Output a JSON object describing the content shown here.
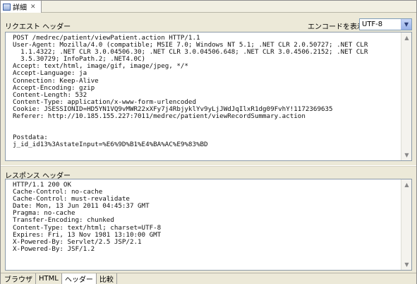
{
  "view": {
    "title": "詳細",
    "close": "✕"
  },
  "request": {
    "label": "リクエスト ヘッダー",
    "encoding_label": "エンコードを表示:",
    "encoding_value": "UTF-8",
    "text": "POST /medrec/patient/viewPatient.action HTTP/1.1\nUser-Agent: Mozilla/4.0 (compatible; MSIE 7.0; Windows NT 5.1; .NET CLR 2.0.50727; .NET CLR\n  1.1.4322; .NET CLR 3.0.04506.30; .NET CLR 3.0.04506.648; .NET CLR 3.0.4506.2152; .NET CLR\n  3.5.30729; InfoPath.2; .NET4.0C)\nAccept: text/html, image/gif, image/jpeg, */*\nAccept-Language: ja\nConnection: Keep-Alive\nAccept-Encoding: gzip\nContent-Length: 532\nContent-Type: application/x-www-form-urlencoded\nCookie: JSESSIONID=HD5YN1VQ9vMWR22xXFy7j4RbjyklYv9yLjJWdJqIlxR1dg09FvhY!1172369635\nReferer: http://10.185.155.227:7011/medrec/patient/viewRecordSummary.action\n\n\nPostdata:\nj_id_id13%3AstateInput=%E6%9D%B1%E4%BA%AC%E9%83%BD"
  },
  "response": {
    "label": "レスポンス ヘッダー",
    "text": "HTTP/1.1 200 OK\nCache-Control: no-cache\nCache-Control: must-revalidate\nDate: Mon, 13 Jun 2011 04:45:37 GMT\nPragma: no-cache\nTransfer-Encoding: chunked\nContent-Type: text/html; charset=UTF-8\nExpires: Fri, 13 Nov 1981 13:10:00 GMT\nX-Powered-By: Servlet/2.5 JSP/2.1\nX-Powered-By: JSF/1.2"
  },
  "tabs": [
    {
      "label": "ブラウザ"
    },
    {
      "label": "HTML"
    },
    {
      "label": "ヘッダー",
      "active": true
    },
    {
      "label": "比較"
    }
  ]
}
